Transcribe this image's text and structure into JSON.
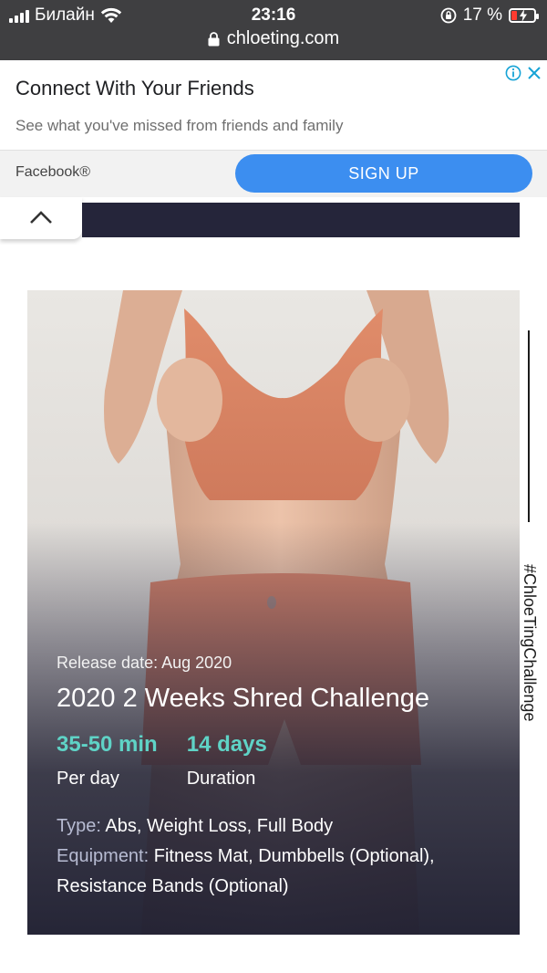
{
  "status_bar": {
    "carrier": "Билайн",
    "time": "23:16",
    "battery_text": "17 %",
    "url": "chloeting.com",
    "icons": [
      "signal-icon",
      "wifi-icon",
      "rotation-lock-icon",
      "battery-charging-icon",
      "padlock-icon"
    ]
  },
  "ad": {
    "title": "Connect With Your Friends",
    "subtitle": "See what you've missed from friends and family",
    "brand": "Facebook®",
    "cta_label": "SIGN UP",
    "cta_color": "#3c8ef0",
    "icons": [
      "info-icon",
      "close-icon",
      "chevron-up-icon"
    ]
  },
  "challenge": {
    "release_label": "Release date: Aug 2020",
    "title": "2020 2 Weeks Shred Challenge",
    "stats": [
      {
        "value": "35-50 min",
        "label": "Per day"
      },
      {
        "value": "14 days",
        "label": "Duration"
      }
    ],
    "type_key": "Type:",
    "type_value": "Abs, Weight Loss, Full Body",
    "equipment_key": "Equipment:",
    "equipment_value": "Fitness Mat, Dumbbells (Optional), Resistance Bands (Optional)",
    "accent_color": "#5fd3c6"
  },
  "side_label": "#ChloeTingChallenge"
}
